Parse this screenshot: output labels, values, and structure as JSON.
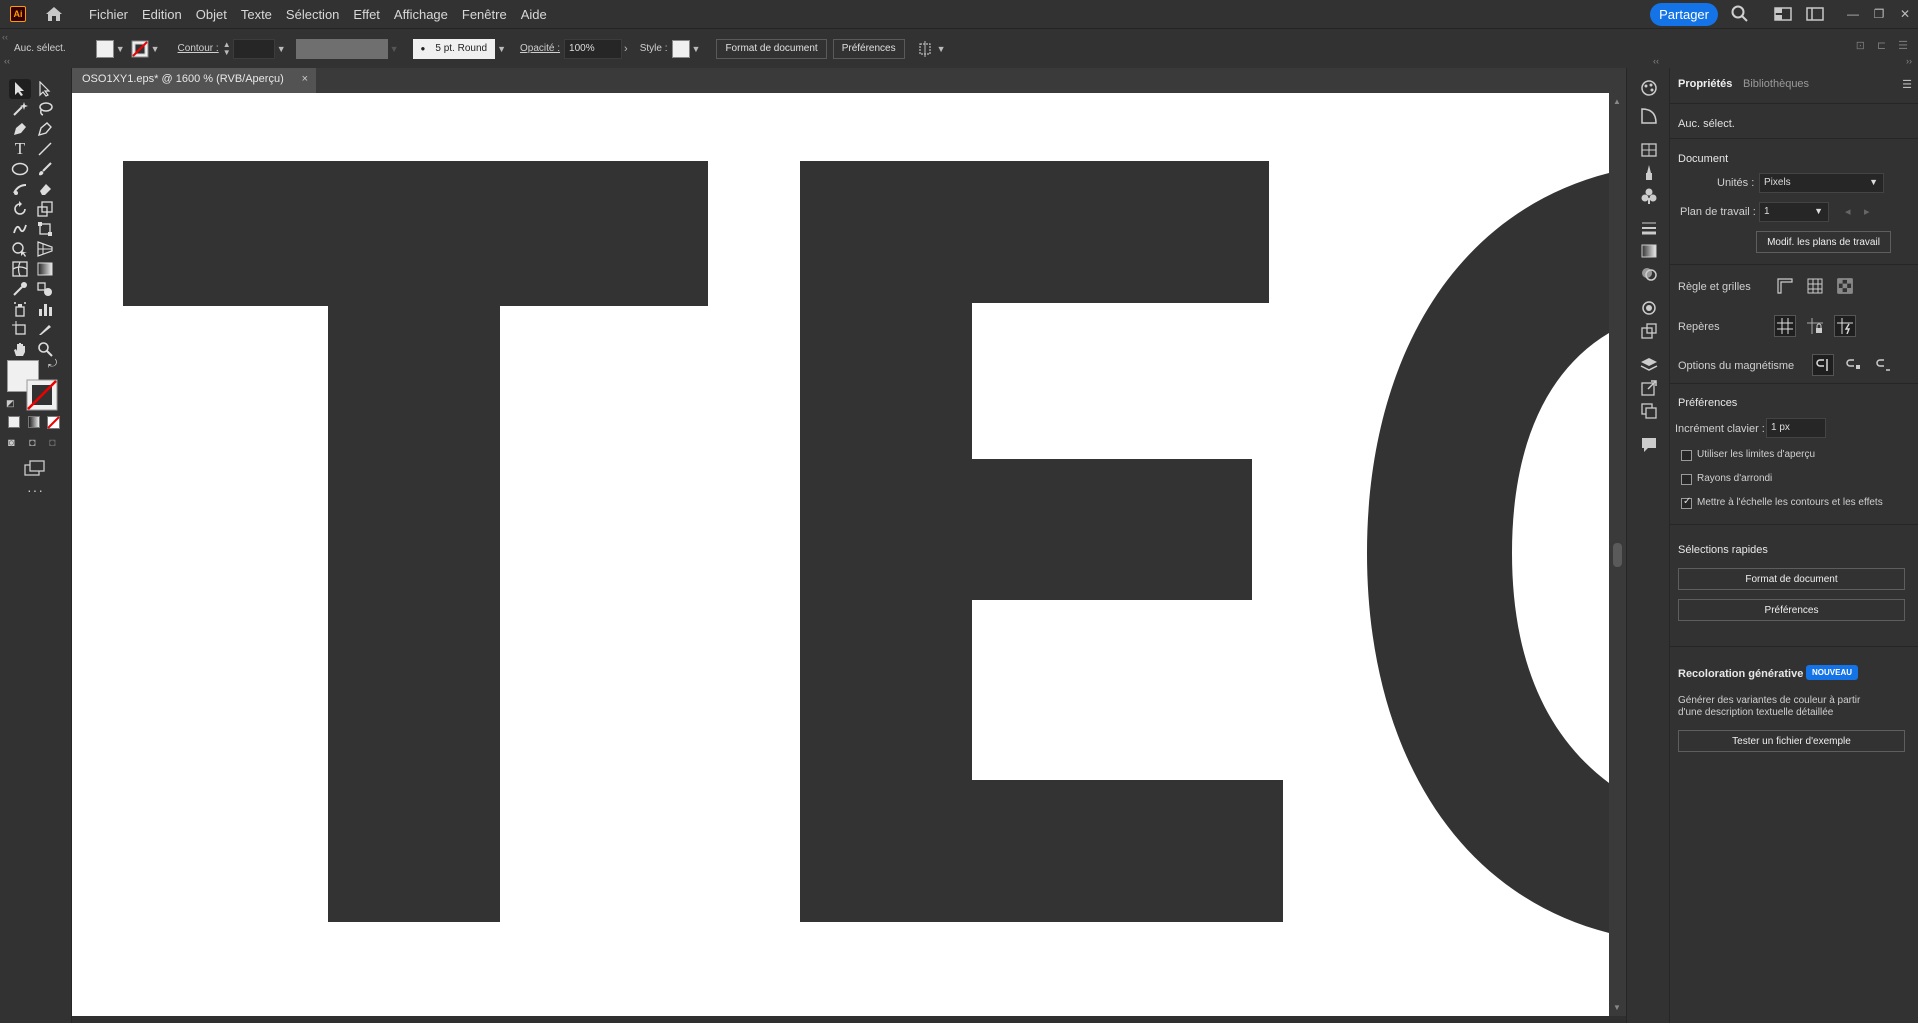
{
  "app": {
    "logo_text": "Ai"
  },
  "menu": [
    "Fichier",
    "Edition",
    "Objet",
    "Texte",
    "Sélection",
    "Effet",
    "Affichage",
    "Fenêtre",
    "Aide"
  ],
  "topright": {
    "share_label": "Partager"
  },
  "control_bar": {
    "selection_label": "Auc. sélect.",
    "contour_label": "Contour :",
    "brush_label": "5 pt. Round",
    "opacity_label": "Opacité :",
    "opacity_value": "100%",
    "style_label": "Style :",
    "doc_format_btn": "Format de document",
    "prefs_btn": "Préférences"
  },
  "document_tab": {
    "title": "OSO1XY1.eps* @ 1600 % (RVB/Aperçu)",
    "close": "×"
  },
  "canvas": {
    "letters": [
      "T",
      "E",
      "O"
    ],
    "fill": "#333333"
  },
  "properties": {
    "tab_properties": "Propriétés",
    "tab_libraries": "Bibliothèques",
    "no_selection": "Auc. sélect.",
    "document_title": "Document",
    "units_label": "Unités :",
    "units_value": "Pixels",
    "artboard_label": "Plan de travail :",
    "artboard_value": "1",
    "edit_artboards_btn": "Modif. les plans de travail",
    "rulers_label": "Règle et grilles",
    "guides_label": "Repères",
    "snap_label": "Options du magnétisme",
    "preferences_title": "Préférences",
    "keyboard_increment_label": "Incrément clavier :",
    "keyboard_increment_value": "1 px",
    "check_preview_bounds": "Utiliser les limites d'aperçu",
    "check_rounded_corners": "Rayons d'arrondi",
    "check_scale_strokes": "Mettre à l'échelle les contours et les effets",
    "quick_actions_title": "Sélections rapides",
    "quick_doc_format_btn": "Format de document",
    "quick_prefs_btn": "Préférences",
    "recolor_title": "Recoloration générative",
    "new_badge": "NOUVEAU",
    "recolor_desc_1": "Générer des variantes de couleur à partir",
    "recolor_desc_2": "d'une description textuelle détaillée",
    "try_sample_btn": "Tester un fichier d'exemple"
  },
  "colors": {
    "accent": "#1473e6",
    "ui_bg": "#323232",
    "canvas_bg": "#ffffff",
    "artwork": "#333333"
  }
}
